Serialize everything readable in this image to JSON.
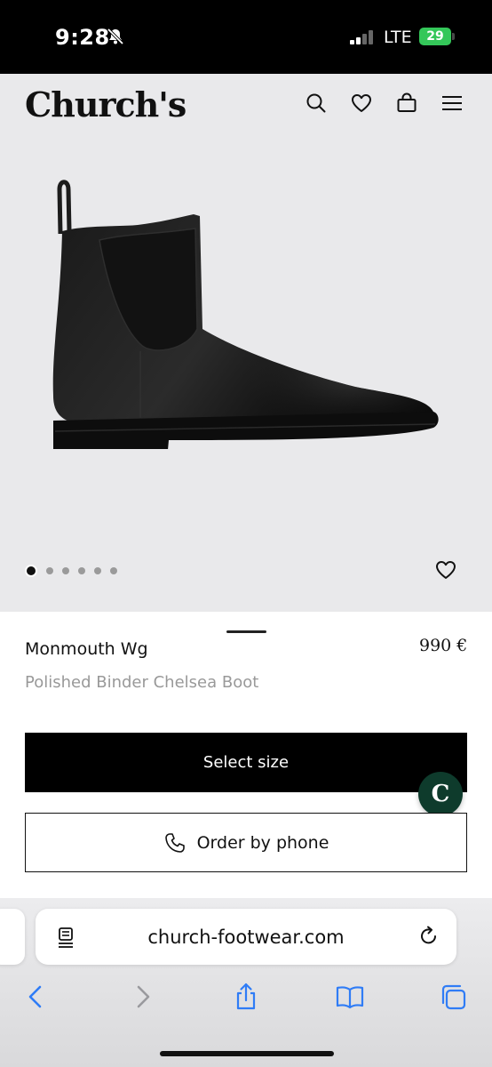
{
  "status_bar": {
    "time": "9:28",
    "network": "LTE",
    "battery": "29",
    "icons": [
      "bell-slash-icon",
      "signal-icon",
      "battery-charging-icon"
    ]
  },
  "header": {
    "logo": "Church's",
    "icons": [
      "search-icon",
      "heart-icon",
      "bag-icon",
      "menu-icon"
    ]
  },
  "gallery": {
    "image": "black-chelsea-boot",
    "image_count": 6,
    "active_index": 0
  },
  "product": {
    "name": "Monmouth Wg",
    "price": "990 €",
    "description": "Polished Binder Chelsea Boot"
  },
  "actions": {
    "select_size": "Select size",
    "order_by_phone": "Order by phone"
  },
  "browser": {
    "url": "church-footwear.com",
    "toolbar_icons": [
      "back-icon",
      "forward-icon",
      "share-icon",
      "bookmarks-icon",
      "tabs-icon"
    ]
  },
  "colors": {
    "background": "#e9e9eb",
    "button": "#000000",
    "chat": "#0e3b2c",
    "safari_blue": "#2f7cf6",
    "battery": "#34c759"
  }
}
